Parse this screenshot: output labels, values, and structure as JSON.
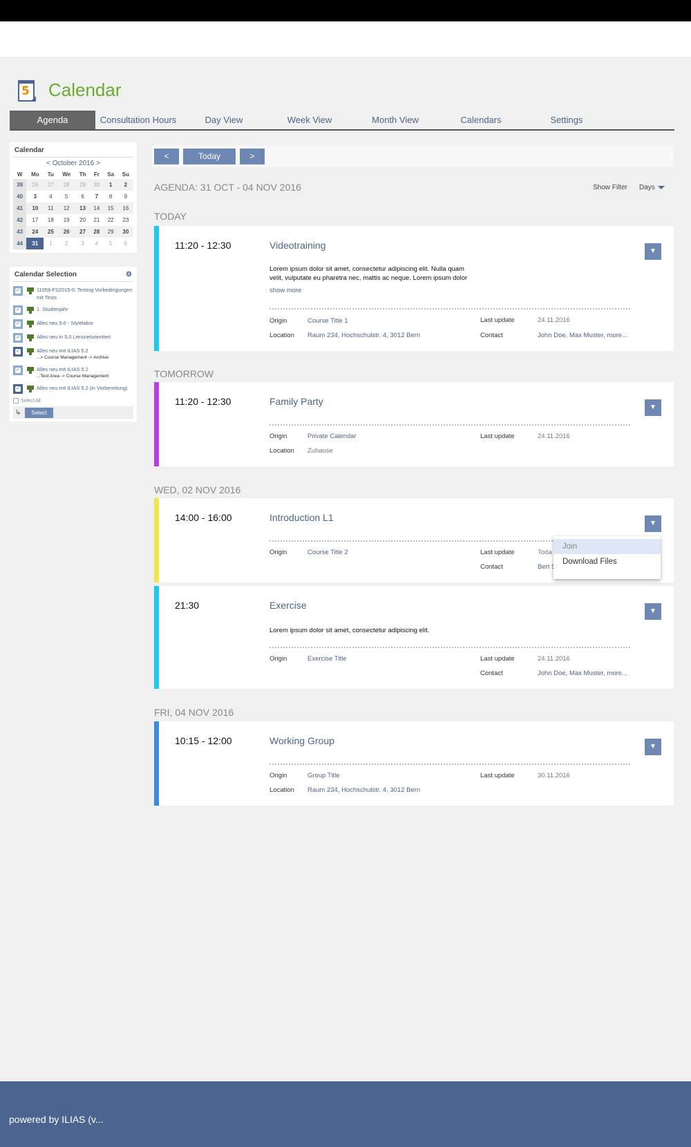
{
  "app": {
    "title": "Calendar",
    "icon_number": "5"
  },
  "tabs": [
    "Agenda",
    "Consultation Hours",
    "Day View",
    "Week View",
    "Month View",
    "Calendars",
    "Settings"
  ],
  "mini_calendar": {
    "title": "Calendar",
    "month_nav": "< October 2016 >",
    "headers": [
      "W",
      "Mo",
      "Tu",
      "We",
      "Th",
      "Fr",
      "Sa",
      "Su"
    ],
    "weeks": [
      [
        "39",
        "26",
        "27",
        "28",
        "29",
        "30",
        "1",
        "2"
      ],
      [
        "40",
        "3",
        "4",
        "5",
        "6",
        "7",
        "8",
        "9"
      ],
      [
        "41",
        "10",
        "11",
        "12",
        "13",
        "14",
        "15",
        "16"
      ],
      [
        "42",
        "17",
        "18",
        "19",
        "20",
        "21",
        "22",
        "23"
      ],
      [
        "43",
        "24",
        "25",
        "26",
        "27",
        "28",
        "29",
        "30"
      ],
      [
        "44",
        "31",
        "1",
        "2",
        "3",
        "4",
        "5",
        "6"
      ]
    ]
  },
  "calendar_selection": {
    "title": "Calendar Selection",
    "items": [
      {
        "label": "11059-FS2015-0: Testing Vorbedingungen mit Tests",
        "sub": ""
      },
      {
        "label": "1. Studienjahr",
        "sub": ""
      },
      {
        "label": "Alles neu 5.0 - Stylelabor",
        "sub": ""
      },
      {
        "label": "Alles neu in 5.0 Lernzielorientiert",
        "sub": ""
      },
      {
        "label": "Alles neu mit ILIAS 5.2",
        "sub": "...> Course Management -> Archive"
      },
      {
        "label": "Alles neu mit ILIAS 5.2",
        "sub": "...Test Area -> Course Management"
      },
      {
        "label": "Alles neu mit ILIAS 5.2 (in Vorbereitung)",
        "sub": ""
      }
    ],
    "select_all": "Select All",
    "select_button": "Select"
  },
  "navigation": {
    "prev": "<",
    "today": "Today",
    "next": ">"
  },
  "agenda": {
    "heading": "AGENDA: 31 OCT - 04 NOV 2016",
    "show_filter": "Show Filter",
    "days_label": "Days"
  },
  "groups": [
    "TODAY",
    "TOMORROW",
    "WED, 02 NOV 2016",
    "FRI, 04 NOV 2016"
  ],
  "labels": {
    "origin": "Origin",
    "location": "Location",
    "last_update": "Last update",
    "contact": "Contact",
    "show_more": "show more"
  },
  "events": [
    {
      "time": "11:20 - 12:30",
      "title": "Videotraining",
      "description": "Lorem ipsum dolor sit amet, consectetur adipiscing elit. Nulla quam velit, vulputate eu pharetra nec, mattis ac neque. Lorem ipsum dolor",
      "origin": "Course Title 1",
      "location": "Raum 234, Hochschulstr. 4, 3012 Bern",
      "last_update": "24.11.2016",
      "contact": "John Doe, Max Muster, more...",
      "color": "#1ec8f0"
    },
    {
      "time": "11:20 - 12:30",
      "title": "Family Party",
      "origin": "Private Calendar",
      "location": "Zuhause",
      "last_update": "24.11.2016",
      "color": "#c03ce8"
    },
    {
      "time": "14:00 - 16:00",
      "title": "Introduction L1",
      "origin": "Course Title 2",
      "last_update": "Toda",
      "contact": "Bert S",
      "color": "#f2e64a"
    },
    {
      "time": "21:30",
      "title": "Exercise",
      "description": "Lorem ipsum dolor sit amet, consectetur adipiscing elit.",
      "origin": "Exercise Title",
      "last_update": "24.11.2016",
      "contact": "John Doe, Max Muster, more...",
      "color": "#1ec8f0"
    },
    {
      "time": "10:15 - 12:00",
      "title": "Working Group",
      "origin": "Group Title",
      "location": "Raum 234, Hochschulstr. 4, 3012 Bern",
      "last_update": "30.11.2016",
      "color": "#3a8ae6"
    }
  ],
  "dropdown": {
    "items": [
      "Join",
      "Download Files"
    ]
  },
  "footer": {
    "text": "powered by ILIAS (v..."
  }
}
